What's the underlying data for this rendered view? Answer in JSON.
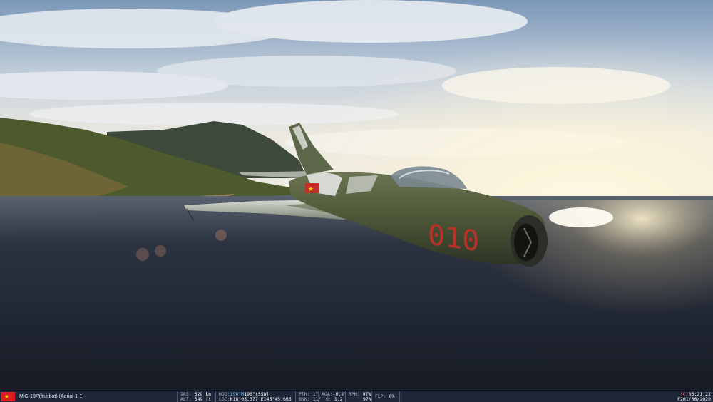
{
  "scene": {
    "description_icons": [
      "mig-19-jet-icon",
      "sun-icon",
      "mountain-icon"
    ],
    "aircraft_number": "010",
    "colors": {
      "sky_top": "#6f8fb3",
      "sky_horizon": "#f3f1ea",
      "sun": "#fffbe8",
      "sea": "#1f2633",
      "land": "#4a5a2e",
      "jet_body": "#4f5b3c",
      "numbers": "#b8322a"
    }
  },
  "hud": {
    "flag_icon": "vietnam-flag-icon",
    "unit_name": "MiG-19P(fruitbat) (Aerial-1-1)",
    "ias_label": "IAS:",
    "ias_value": "529 kn",
    "alt_label": "ALT:",
    "alt_value": "549 ft",
    "hdg_label": "HDG:",
    "hdg_value_cyan": "196°M",
    "hdg_value": "196°(SSW)",
    "loc_label": "LOC:",
    "loc_value": "N18°05.377 E145°45.665",
    "pth_label": "PTH:",
    "pth_value": "1°",
    "bnk_label": "BNK:",
    "bnk_value": "11°",
    "aoa_label": "AOA:",
    "aoa_value": "-0.2°",
    "g_label": "G:",
    "g_value": "1.2",
    "rpm_label": "RPM:",
    "rpm_value_1": "97%",
    "rpm_value_2": "97%",
    "flp_label": "FLP:",
    "flp_value": "0%",
    "time_prefix": "(C)",
    "time": "06:21:22",
    "date": "F201/06/2020"
  }
}
